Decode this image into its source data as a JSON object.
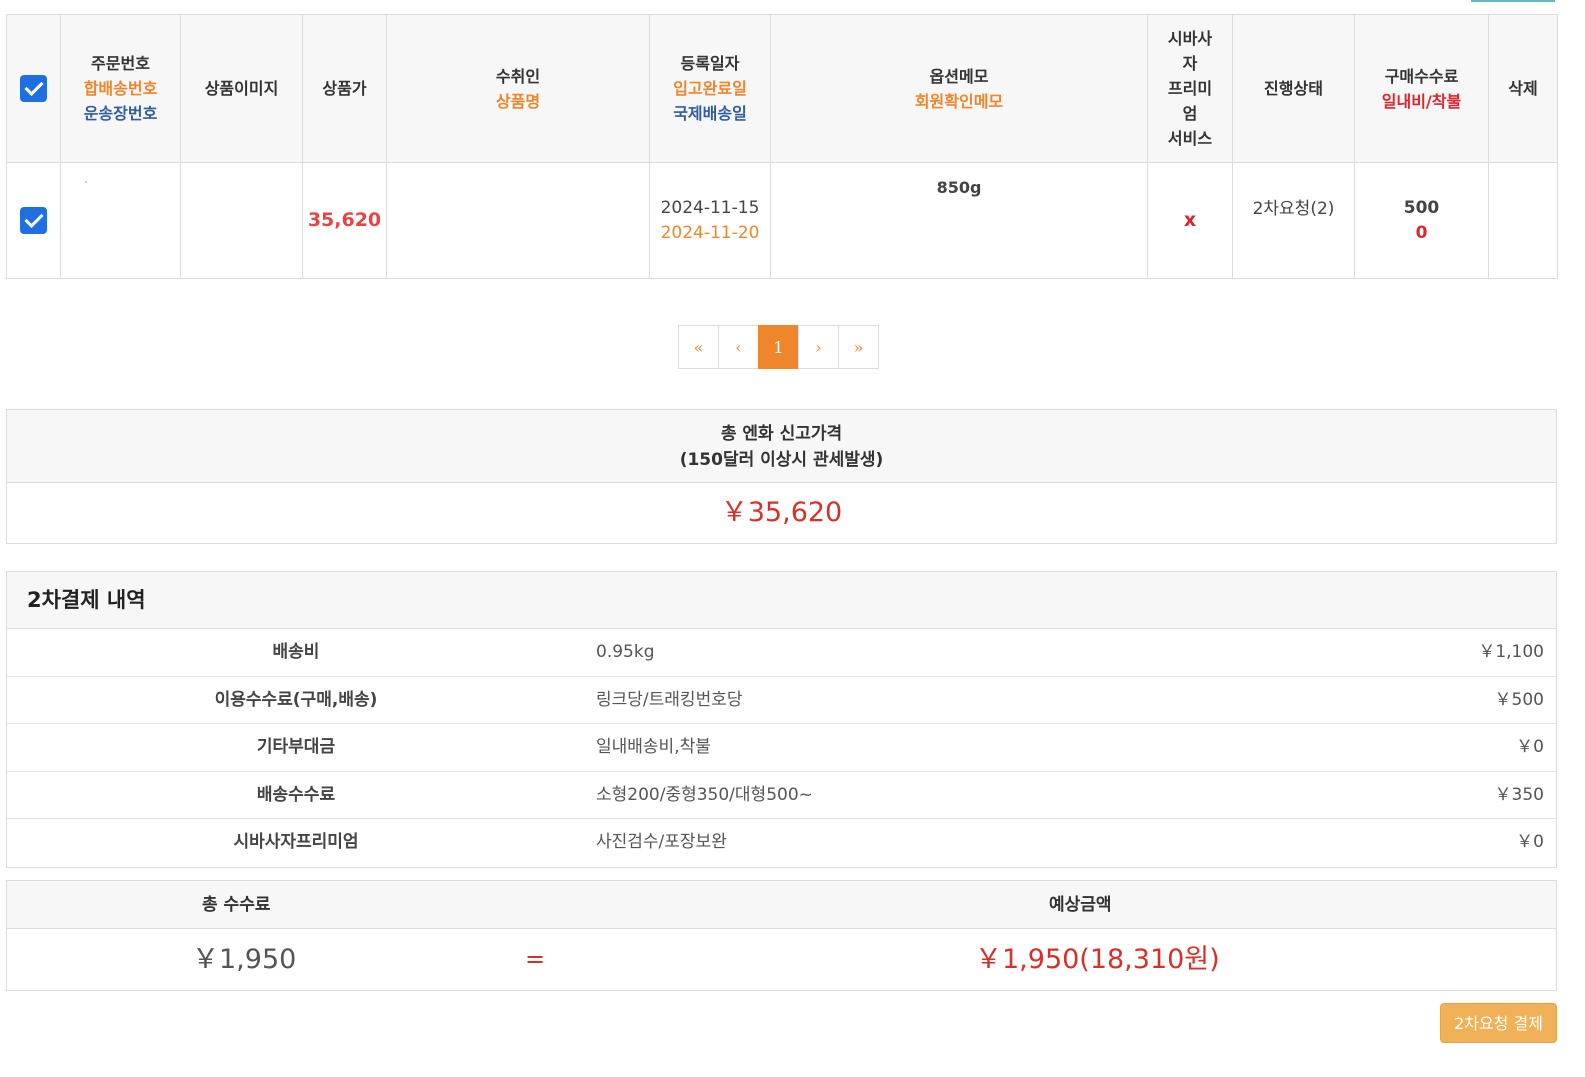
{
  "table": {
    "headers": {
      "order_no": "주문번호",
      "combined_no": "합배송번호",
      "tracking_no": "운송장번호",
      "product_image": "상품이미지",
      "product_price": "상품가",
      "recipient": "수취인",
      "product_name": "상품명",
      "reg_date": "등록일자",
      "stock_date": "입고완료일",
      "intl_ship_date": "국제배송일",
      "option_memo": "옵션메모",
      "member_memo": "회원확인메모",
      "premium_lines": [
        "시바사",
        "자",
        "프리미",
        "엄",
        "서비스"
      ],
      "status": "진행상태",
      "purchase_fee": "구매수수료",
      "jp_ship_cod": "일내비/착불",
      "delete": "삭제"
    },
    "row": {
      "price": "35,620",
      "reg_date": "2024-11-15",
      "stock_date": "2024-11-20",
      "option_memo": "850g",
      "premium": "x",
      "status": "2차요청(2)",
      "purchase_fee": "500",
      "jp_ship_cod": "0"
    }
  },
  "pagination": {
    "first": "«",
    "prev": "‹",
    "current": "1",
    "next": "›",
    "last": "»"
  },
  "declared": {
    "title": "총 엔화 신고가격",
    "subtitle": "(150달러 이상시 관세발생)",
    "value": "￥35,620"
  },
  "payment2": {
    "title": "2차결제 내역",
    "rows": [
      {
        "label": "배송비",
        "desc": "0.95kg",
        "amount": "￥1,100"
      },
      {
        "label": "이용수수료(구매,배송)",
        "desc": "링크당/트래킹번호당",
        "amount": "￥500"
      },
      {
        "label": "기타부대금",
        "desc": "일내배송비,착불",
        "amount": "￥0"
      },
      {
        "label": "배송수수료",
        "desc": "소형200/중형350/대형500~",
        "amount": "￥350"
      },
      {
        "label": "시바사자프리미엄",
        "desc": "사진검수/포장보완",
        "amount": "￥0"
      }
    ]
  },
  "totals": {
    "fee_label": "총 수수료",
    "expected_label": "예상금액",
    "fee_value": "￥1,950",
    "equals": "=",
    "expected_value": "￥1,950(18,310원)"
  },
  "pay_button": "2차요청 결제",
  "colors": {
    "accent_orange": "#f0862c",
    "blue": "#2f5d9e",
    "red": "#e2232d",
    "checkbox": "#1f6fe0",
    "button": "#f0b158"
  }
}
